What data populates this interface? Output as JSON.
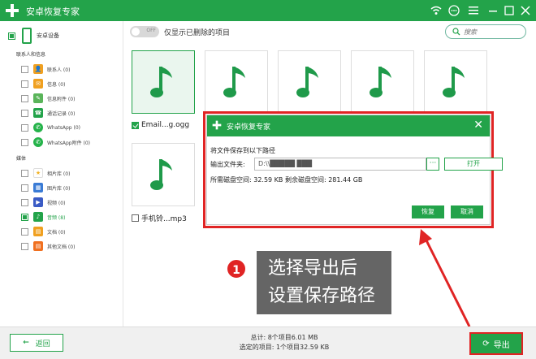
{
  "titlebar": {
    "title": "安卓恢复专家"
  },
  "sidebar": {
    "device_label": "安卓设备",
    "contacts_section": "联系人和信息",
    "contacts_items": [
      {
        "label": "联系人 (0)",
        "icon": "contacts-icon",
        "color": "#f0a020",
        "checked": false
      },
      {
        "label": "信息 (0)",
        "icon": "messages-icon",
        "color": "#f0a020",
        "checked": false
      },
      {
        "label": "信息附件 (0)",
        "icon": "message-attachment-icon",
        "color": "#5ab45a",
        "checked": false
      },
      {
        "label": "通话记录 (0)",
        "icon": "call-log-icon",
        "color": "#23a34a",
        "checked": false
      },
      {
        "label": "WhatsApp (0)",
        "icon": "whatsapp-icon",
        "color": "#25b34a",
        "checked": false
      },
      {
        "label": "WhatsApp附件 (0)",
        "icon": "whatsapp-attachment-icon",
        "color": "#25b34a",
        "checked": false
      }
    ],
    "media_section": "媒体",
    "media_items": [
      {
        "label": "相片库 (0)",
        "icon": "gallery-icon",
        "color": "#f0b020",
        "checked": false
      },
      {
        "label": "图片库 (0)",
        "icon": "picture-library-icon",
        "color": "#3a7bd5",
        "checked": false
      },
      {
        "label": "视频 (0)",
        "icon": "video-icon",
        "color": "#3a5bc5",
        "checked": false
      },
      {
        "label": "音频 (8)",
        "icon": "audio-icon",
        "color": "#23a34a",
        "checked": true
      },
      {
        "label": "文档 (0)",
        "icon": "document-icon",
        "color": "#f0a020",
        "checked": false
      },
      {
        "label": "其他文档 (0)",
        "icon": "other-document-icon",
        "color": "#f07020",
        "checked": false
      }
    ]
  },
  "toolbar": {
    "toggle_text": "OFF",
    "only_deleted_label": "仅显示已删除的项目",
    "search_placeholder": "搜索"
  },
  "files": [
    {
      "caption": "Email...g.ogg",
      "checked": true
    },
    {
      "caption": "手机铃...mp3",
      "checked": false
    }
  ],
  "dialog": {
    "title": "安卓恢复专家",
    "save_to_label": "将文件保存到以下路径",
    "output_folder_label": "输出文件夹:",
    "output_path": "D:\\\\█████ ███",
    "browse_label": "···",
    "open_label": "打开",
    "space_line": "所需磁盘空间:  32.59 KB  剩余磁盘空间:  281.44 GB",
    "recover_label": "恢复",
    "cancel_label": "取消"
  },
  "bottombar": {
    "back_label": "返回",
    "total_line": "总计: 8个项目6.01 MB",
    "selected_line": "选定的项目: 1个项目32.59 KB",
    "export_label": "导出"
  },
  "annotation": {
    "number": "1",
    "line1": "选择导出后",
    "line2": "设置保存路径"
  },
  "colors": {
    "brand": "#23a34a",
    "highlight": "#e02424"
  }
}
